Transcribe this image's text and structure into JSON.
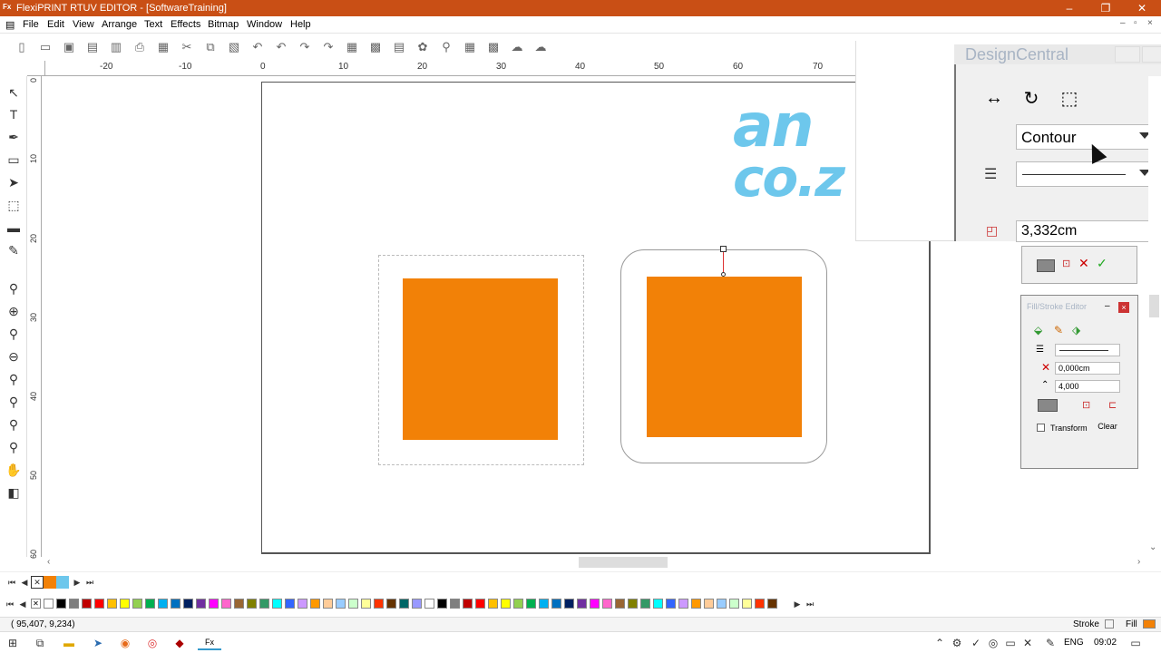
{
  "window": {
    "title": "FlexiPRINT RTUV EDITOR - [SoftwareTraining]",
    "app_icon": "Fx"
  },
  "menus": [
    "File",
    "Edit",
    "View",
    "Arrange",
    "Text",
    "Effects",
    "Bitmap",
    "Window",
    "Help"
  ],
  "ruler_top_labels": [
    "-20",
    "-10",
    "0",
    "10",
    "20",
    "30",
    "40",
    "50",
    "60",
    "70"
  ],
  "ruler_left_labels": [
    "0",
    "10",
    "20",
    "30",
    "40",
    "50",
    "60"
  ],
  "canvas": {
    "shape_color": "#f28107",
    "logo_color": "#6dc7ec",
    "logo_line1": "an",
    "logo_line2": "co.z"
  },
  "design_central": {
    "title": "DesignCentral",
    "mode_value": "Contour",
    "offset_value": "3,332cm"
  },
  "fill_stroke_editor": {
    "title": "Fill/Stroke Editor",
    "width_value": "0,000cm",
    "miter_value": "4,000",
    "transform_label": "Transform",
    "clear_label": "Clear"
  },
  "status": {
    "coords": "( 95,407,    9,234)",
    "stroke_label": "Stroke",
    "fill_label": "Fill"
  },
  "taskbar": {
    "language": "ENG",
    "time": "09:02",
    "active_app": "Fx"
  },
  "palette_colors": [
    "#ffffff",
    "#000000",
    "#7f7f7f",
    "#c00000",
    "#ff0000",
    "#ffc000",
    "#ffff00",
    "#92d050",
    "#00b050",
    "#00b0f0",
    "#0070c0",
    "#002060",
    "#7030a0",
    "#ff00ff",
    "#ff66cc",
    "#996633",
    "#808000",
    "#339966",
    "#00ffff",
    "#3366ff",
    "#cc99ff",
    "#ff9900",
    "#ffcc99",
    "#99ccff",
    "#ccffcc",
    "#ffff99",
    "#ff3300",
    "#663300",
    "#006666",
    "#9999ff"
  ]
}
